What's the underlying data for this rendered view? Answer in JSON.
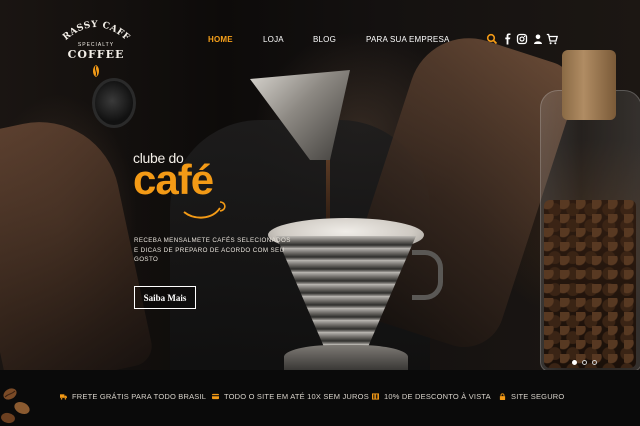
{
  "brand": {
    "name_arc": "GRASSY CAFFE",
    "specialty": "SPECIALTY",
    "coffee": "COFFEE",
    "accent_color": "#f39a16"
  },
  "nav": {
    "items": [
      {
        "label": "HOME",
        "active": true
      },
      {
        "label": "LOJA",
        "active": false
      },
      {
        "label": "BLOG",
        "active": false
      },
      {
        "label": "PARA SUA EMPRESA",
        "active": false
      }
    ],
    "icons": [
      "search-icon",
      "facebook-icon",
      "instagram-icon",
      "user-icon",
      "cart-icon"
    ]
  },
  "hero": {
    "title_small": "clube do",
    "title_big": "café",
    "description": "RECEBA MENSALMETE CAFÉS SELECIONADOS E DICAS DE PREPARO DE ACORDO COM SEU GOSTO",
    "cta_label": "Saiba Mais",
    "slides": {
      "count": 3,
      "active": 1
    }
  },
  "benefits": [
    {
      "icon": "truck-icon",
      "label": "FRETE GRÁTIS PARA TODO BRASIL"
    },
    {
      "icon": "credit-card-icon",
      "label": "TODO O SITE EM ATÉ 10X SEM JUROS"
    },
    {
      "icon": "barcode-icon",
      "label": "10% DE DESCONTO À VISTA"
    },
    {
      "icon": "lock-icon",
      "label": "SITE SEGURO"
    }
  ]
}
